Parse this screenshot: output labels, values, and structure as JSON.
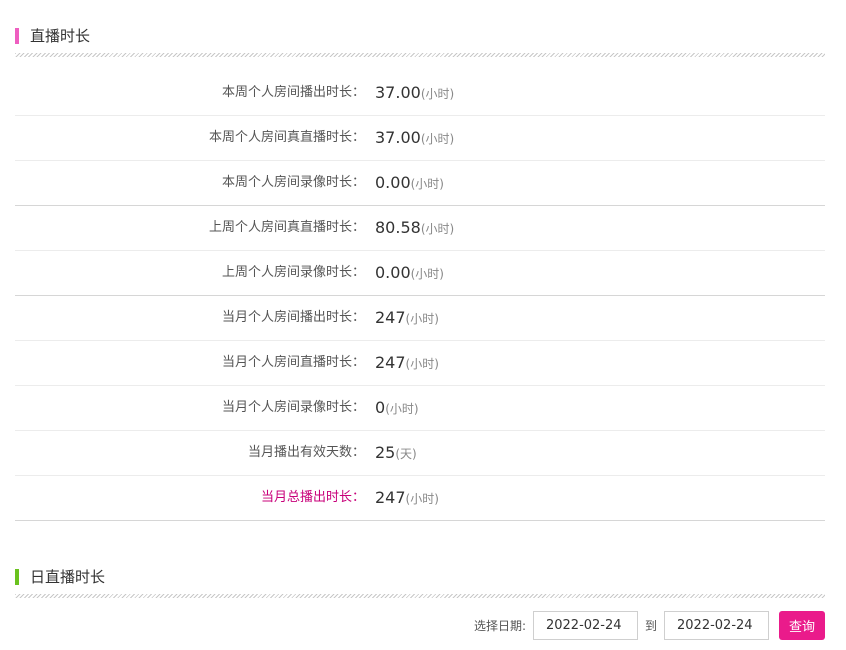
{
  "live_duration": {
    "title": "直播时长",
    "accent_color": "#ee5ec0",
    "rows": [
      {
        "label": "本周个人房间播出时长：",
        "value": "37.00",
        "unit": "(小时)"
      },
      {
        "label": "本周个人房间真直播时长：",
        "value": "37.00",
        "unit": "(小时)"
      },
      {
        "label": "本周个人房间录像时长：",
        "value": "0.00",
        "unit": "(小时)"
      },
      {
        "label": "上周个人房间真直播时长：",
        "value": "80.58",
        "unit": "(小时)"
      },
      {
        "label": "上周个人房间录像时长：",
        "value": "0.00",
        "unit": "(小时)"
      },
      {
        "label": "当月个人房间播出时长：",
        "value": "247",
        "unit": "(小时)"
      },
      {
        "label": "当月个人房间直播时长：",
        "value": "247",
        "unit": "(小时)"
      },
      {
        "label": "当月个人房间录像时长：",
        "value": "0",
        "unit": "(小时)"
      },
      {
        "label": "当月播出有效天数：",
        "value": "25",
        "unit": "(天)"
      },
      {
        "label": "当月总播出时长：",
        "value": "247",
        "unit": "(小时)"
      }
    ]
  },
  "daily_duration": {
    "title": "日直播时长",
    "accent_color": "#6ac21e",
    "filter": {
      "date_label": "选择日期:",
      "start_date": "2022-02-24",
      "to_label": "到",
      "end_date": "2022-02-24",
      "query_label": "查询",
      "button_color": "#ea1b8b"
    }
  }
}
